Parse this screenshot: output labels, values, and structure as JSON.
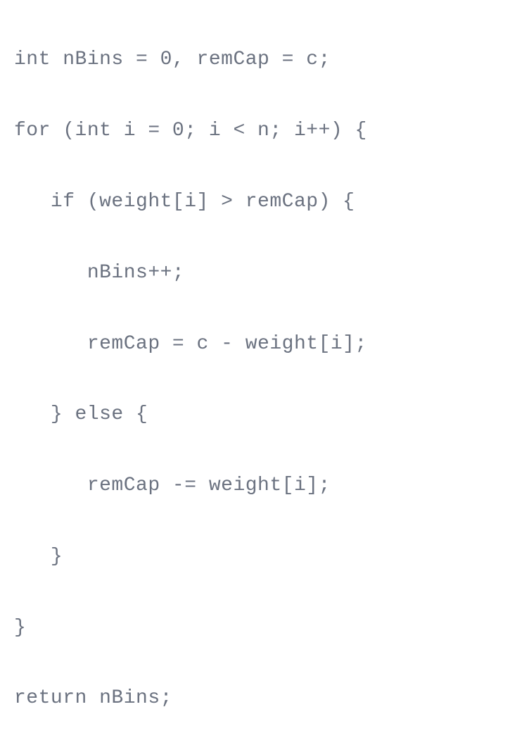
{
  "code": {
    "line1": "int nBins = 0, remCap = c;",
    "line2": "for (int i = 0; i < n; i++) {",
    "line3": "   if (weight[i] > remCap) {",
    "line4": "      nBins++;",
    "line5": "      remCap = c - weight[i];",
    "line6": "   } else {",
    "line7": "      remCap -= weight[i];",
    "line8": "   }",
    "line9": "}",
    "line10": "return nBins;"
  }
}
